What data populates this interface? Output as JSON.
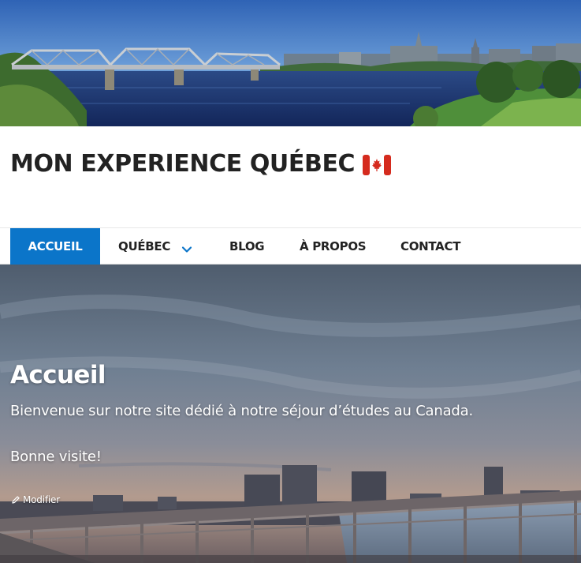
{
  "site": {
    "title": "MON EXPERIENCE QUÉBEC",
    "flag_icon": "canada-flag-icon"
  },
  "nav": {
    "items": [
      {
        "label": "ACCUEIL",
        "active": true
      },
      {
        "label": "QUÉBEC",
        "has_dropdown": true,
        "dropdown_icon": "chevron-down-icon"
      },
      {
        "label": "BLOG"
      },
      {
        "label": "À PROPOS"
      },
      {
        "label": "CONTACT"
      }
    ]
  },
  "hero": {
    "title": "Accueil",
    "line1": "Bienvenue sur notre site dédié à notre séjour d’études au Canada.",
    "line2": "Bonne visite!",
    "edit_label": "Modifier",
    "edit_icon": "pencil-icon"
  },
  "colors": {
    "accent": "#0b75c9",
    "text": "#222222",
    "flag_red": "#d52b1e"
  }
}
